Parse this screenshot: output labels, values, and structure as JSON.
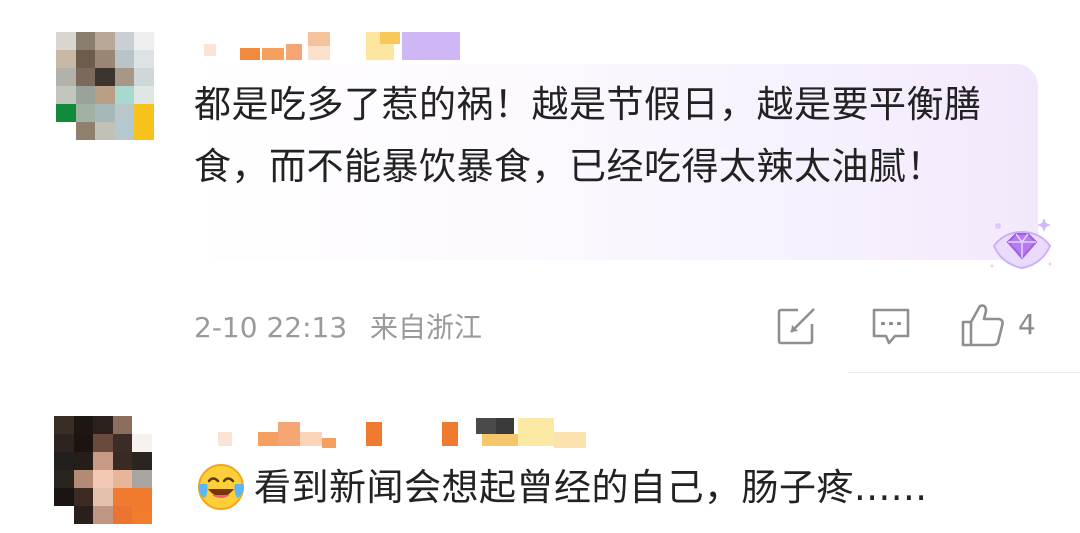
{
  "comments": [
    {
      "text": "都是吃多了惹的祸！越是节假日，越是要平衡膳食，而不能暴饮暴食，已经吃得太辣太油腻！",
      "meta": {
        "date": "2-10 22:13",
        "location": "来自浙江"
      },
      "actions": {
        "like_count": "4"
      },
      "badge_icon": "diamond-badge-icon"
    },
    {
      "text": "看到新闻会想起曾经的自己，肠子疼......",
      "emoji_icon": "laugh-cry-emoji-icon"
    }
  ],
  "colors": {
    "text": "#222222",
    "meta": "#9a9a9a",
    "bubble_accent": "#f2e8fb",
    "badge": "#b078f0"
  }
}
